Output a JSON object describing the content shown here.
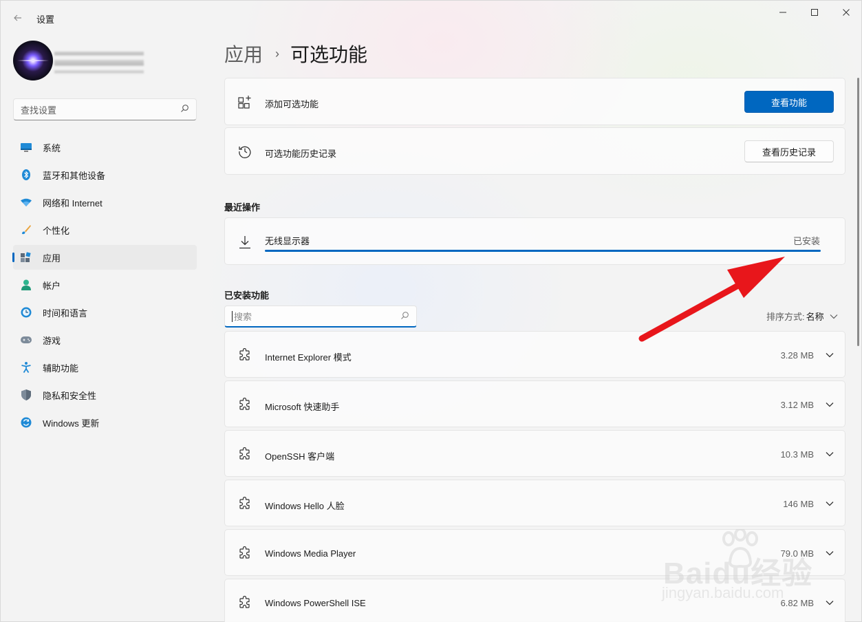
{
  "window": {
    "title": "设置",
    "controls": {
      "minimize": "—",
      "maximize": "☐",
      "close": "✕"
    }
  },
  "sidebar": {
    "search_placeholder": "查找设置",
    "items": [
      {
        "label": "系统",
        "icon": "system-icon",
        "active": false
      },
      {
        "label": "蓝牙和其他设备",
        "icon": "bluetooth-icon",
        "active": false
      },
      {
        "label": "网络和 Internet",
        "icon": "wifi-icon",
        "active": false
      },
      {
        "label": "个性化",
        "icon": "brush-icon",
        "active": false
      },
      {
        "label": "应用",
        "icon": "apps-icon",
        "active": true
      },
      {
        "label": "帐户",
        "icon": "account-icon",
        "active": false
      },
      {
        "label": "时间和语言",
        "icon": "time-language-icon",
        "active": false
      },
      {
        "label": "游戏",
        "icon": "gamepad-icon",
        "active": false
      },
      {
        "label": "辅助功能",
        "icon": "accessibility-icon",
        "active": false
      },
      {
        "label": "隐私和安全性",
        "icon": "shield-icon",
        "active": false
      },
      {
        "label": "Windows 更新",
        "icon": "update-icon",
        "active": false
      }
    ]
  },
  "header": {
    "parent": "应用",
    "separator": "›",
    "current": "可选功能"
  },
  "add_card": {
    "label": "添加可选功能",
    "button": "查看功能"
  },
  "history_card": {
    "label": "可选功能历史记录",
    "button": "查看历史记录"
  },
  "recent": {
    "heading": "最近操作",
    "item": {
      "label": "无线显示器",
      "status": "已安装",
      "progress": 1.0
    }
  },
  "installed": {
    "heading": "已安装功能",
    "search_placeholder": "搜索",
    "sort_label": "排序方式:",
    "sort_value": "名称",
    "features": [
      {
        "name": "Internet Explorer 模式",
        "size": "3.28 MB"
      },
      {
        "name": "Microsoft 快速助手",
        "size": "3.12 MB"
      },
      {
        "name": "OpenSSH 客户端",
        "size": "10.3 MB"
      },
      {
        "name": "Windows Hello 人脸",
        "size": "146 MB"
      },
      {
        "name": "Windows Media Player",
        "size": "79.0 MB"
      },
      {
        "name": "Windows PowerShell ISE",
        "size": "6.82 MB"
      }
    ]
  },
  "watermark": {
    "main": "Baidu经验",
    "sub": "jingyan.baidu.com"
  },
  "colors": {
    "accent": "#0067c0",
    "annotation_arrow": "#e8161b"
  }
}
